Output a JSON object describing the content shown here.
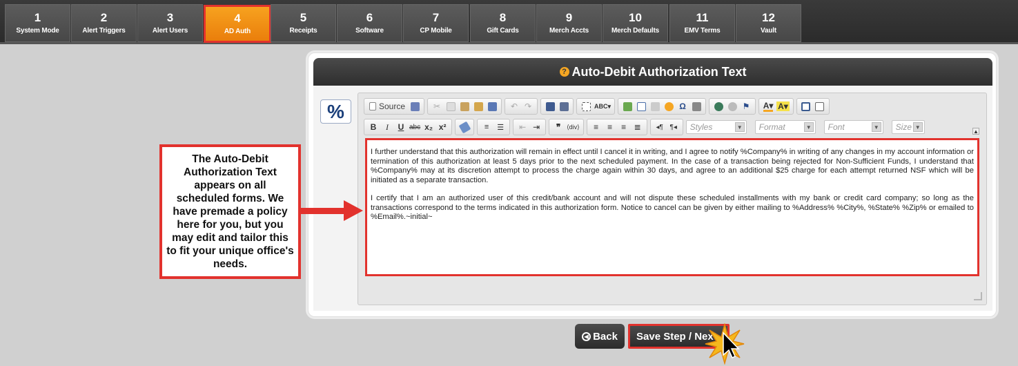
{
  "steps": [
    {
      "num": "1",
      "label": "System Mode"
    },
    {
      "num": "2",
      "label": "Alert Triggers"
    },
    {
      "num": "3",
      "label": "Alert Users"
    },
    {
      "num": "4",
      "label": "AD Auth",
      "active": true
    },
    {
      "num": "5",
      "label": "Receipts"
    },
    {
      "num": "6",
      "label": "Software"
    },
    {
      "num": "7",
      "label": "CP Mobile"
    },
    {
      "num": "8",
      "label": "Gift Cards"
    },
    {
      "num": "9",
      "label": "Merch Accts"
    },
    {
      "num": "10",
      "label": "Merch Defaults"
    },
    {
      "num": "11",
      "label": "EMV Terms"
    },
    {
      "num": "12",
      "label": "Vault"
    }
  ],
  "panel": {
    "title": "Auto-Debit Authorization Text",
    "help_icon": "?",
    "placeholder_button": "%"
  },
  "toolbar": {
    "source_label": "Source",
    "styles_label": "Styles",
    "format_label": "Format",
    "font_label": "Font",
    "size_label": "Size"
  },
  "editor": {
    "paragraph1": "I further understand that this authorization will remain in effect until I cancel it in writing, and I agree to notify %Company% in writing of any changes in my account information or termination of this authorization at least 5 days prior to the next scheduled payment. In the case of a transaction being rejected for Non-Sufficient Funds, I understand that %Company% may at its discretion attempt to process the charge again within 30 days, and agree to an additional $25 charge for each attempt returned NSF which will be initiated as a separate transaction.",
    "paragraph2": "I certify that I am an authorized user of this credit/bank account and will not dispute these scheduled installments with my bank or credit card company; so long as the transactions correspond to the terms indicated in this authorization form.  Notice to cancel can be given by either mailing to %Address% %City%, %State% %Zip% or emailed to %Email%.~initial~"
  },
  "callout": {
    "text": "The Auto-Debit Authorization Text appears on all scheduled forms. We have premade a policy here for you, but you may edit and tailor this to fit your unique office's needs."
  },
  "buttons": {
    "back": "Back",
    "next": "Save Step / Next"
  },
  "colors": {
    "accent_orange": "#f39318",
    "highlight_red": "#e2322d",
    "dark_bar": "#2e2e2e"
  }
}
